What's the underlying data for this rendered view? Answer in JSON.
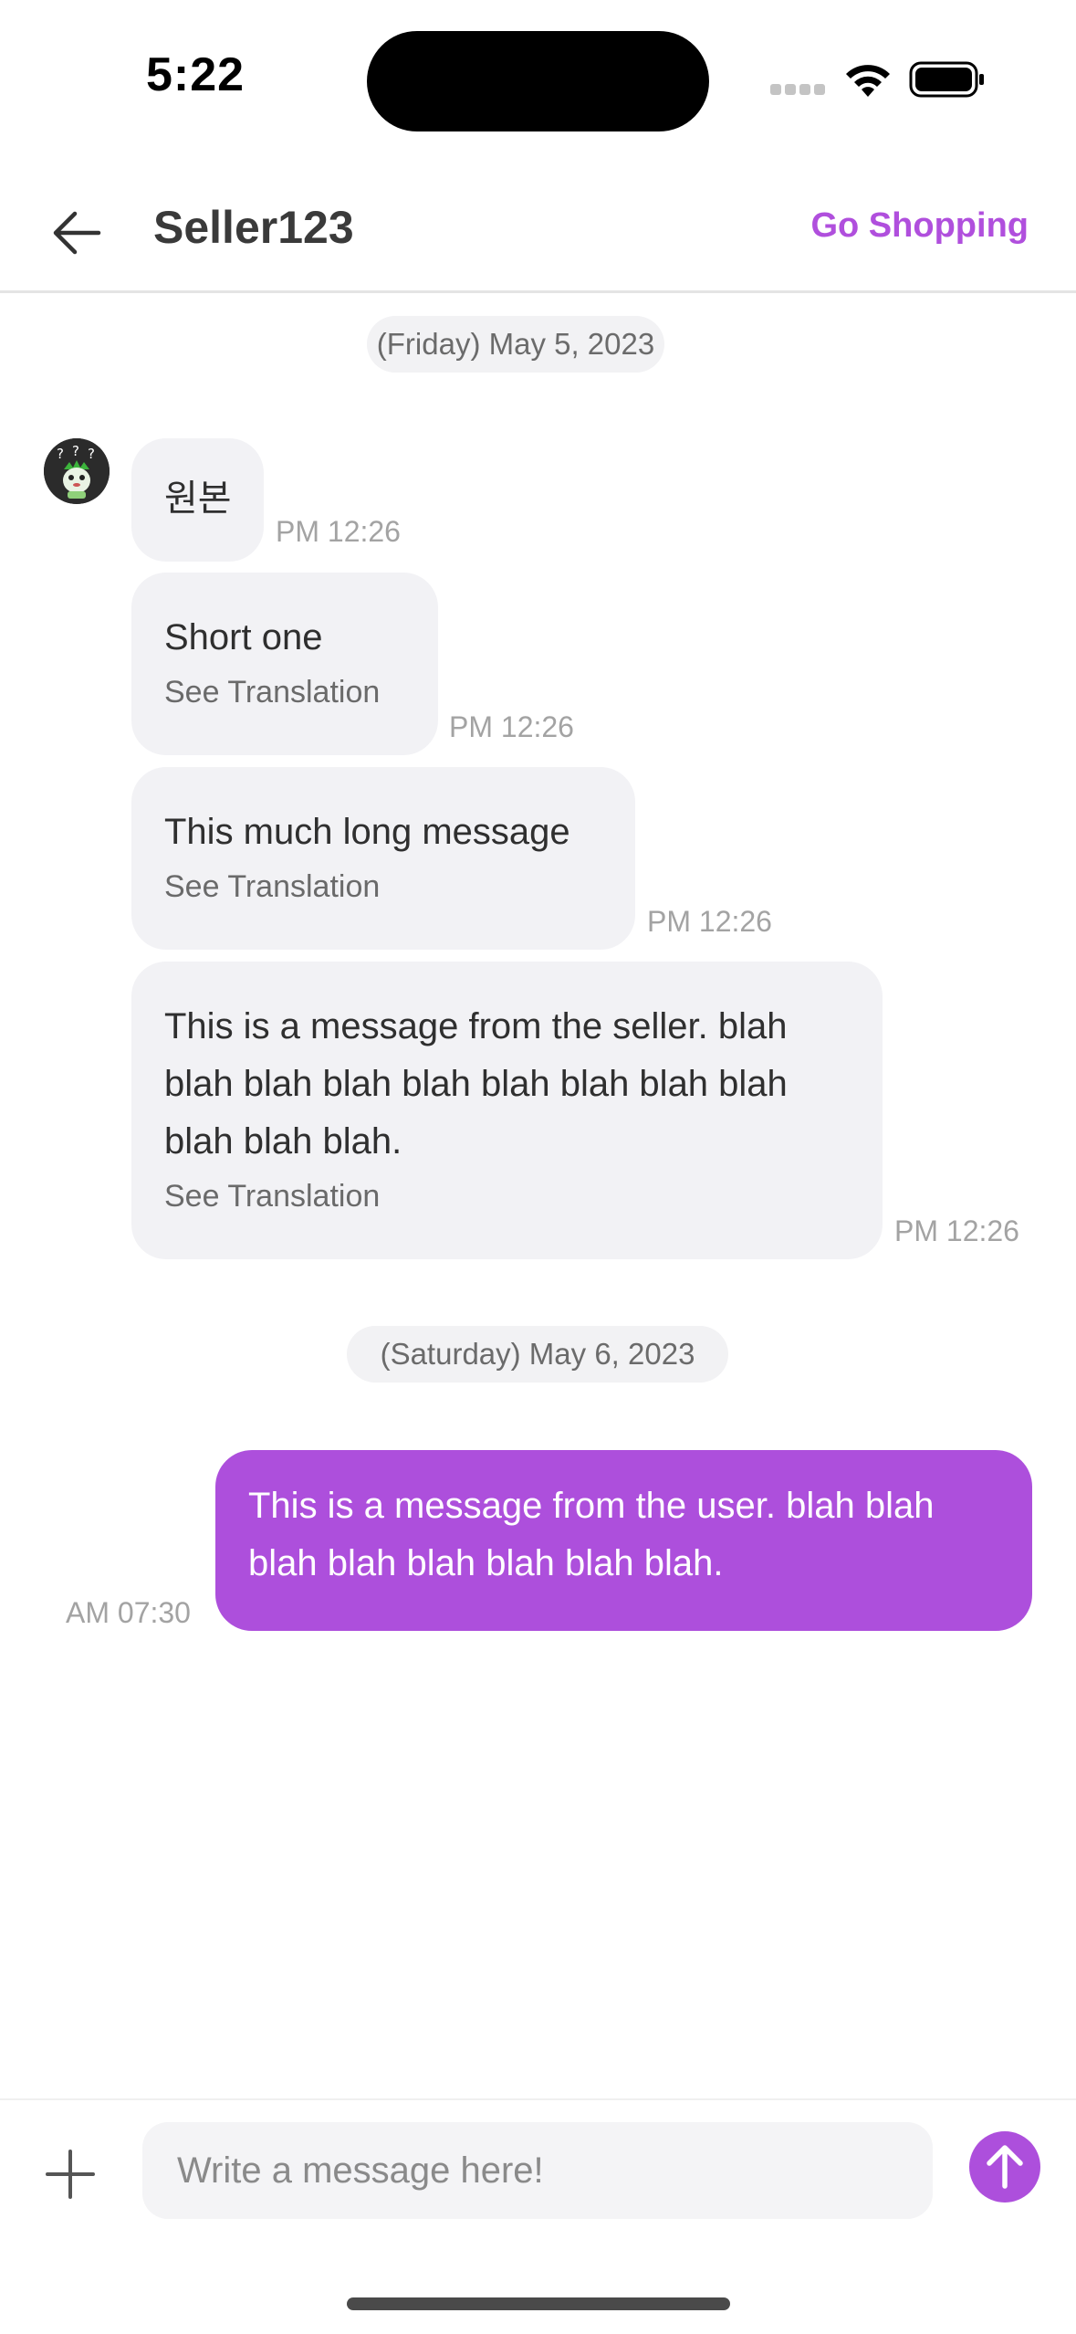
{
  "status_bar": {
    "time": "5:22"
  },
  "header": {
    "title": "Seller123",
    "action_label": "Go Shopping",
    "back_icon": "arrow-left-icon"
  },
  "colors": {
    "accent": "#ad4fdc",
    "bubble_incoming": "#f2f2f5",
    "date_pill": "#f2f2f4"
  },
  "conversation": {
    "days": [
      {
        "date_label": "(Friday) May 5, 2023",
        "messages": [
          {
            "sender": "seller",
            "text": "원본",
            "time": "PM 12:26"
          },
          {
            "sender": "seller",
            "text": "Short one",
            "translate_label": "See Translation",
            "time": "PM 12:26"
          },
          {
            "sender": "seller",
            "text": "This much long message",
            "translate_label": "See Translation",
            "time": "PM 12:26"
          },
          {
            "sender": "seller",
            "text": "This is a message from the seller. blah blah blah blah blah blah blah blah blah blah blah blah.",
            "translate_label": "See Translation",
            "time": "PM 12:26"
          }
        ]
      },
      {
        "date_label": "(Saturday) May 6, 2023",
        "messages": [
          {
            "sender": "user",
            "text": "This is a message from the user. blah blah blah blah blah blah blah blah.",
            "time": "AM 07:30"
          }
        ]
      }
    ]
  },
  "composer": {
    "placeholder": "Write a message here!",
    "value": "",
    "attach_icon": "plus-icon",
    "send_icon": "arrow-up-icon"
  }
}
